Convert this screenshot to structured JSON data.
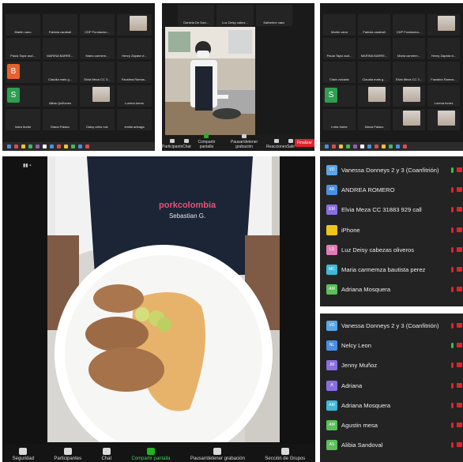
{
  "colors": {
    "panel_bg": "#1a1a1a",
    "tile_bg": "#242424",
    "mic_on": "#35c24a",
    "muted": "#e0232f",
    "share_green": "#1fb51f"
  },
  "panel_top_left": {
    "corner_label": "⊞ ⊟",
    "tiles": [
      {
        "name": "Martin vano"
      },
      {
        "name": "Fabiola carabali"
      },
      {
        "name": "CDP Fundacion..."
      },
      {
        "name": "",
        "thumb": true
      },
      {
        "name": "Paula Tapiz aud..."
      },
      {
        "name": "MARINA BARRE..."
      },
      {
        "name": "Maria carmem..."
      },
      {
        "name": "Henry Zapata vi..."
      },
      {
        "name": "",
        "avatar": "B",
        "avatar_color": "#e8612c"
      },
      {
        "name": "Claudia mats g..."
      },
      {
        "name": "Elvia Meza CC 3..."
      },
      {
        "name": "Faustina Ramos..."
      },
      {
        "name": "",
        "avatar": "S",
        "avatar_color": "#2e9e4f"
      },
      {
        "name": "Alibia Quiñones"
      },
      {
        "name": "",
        "thumb": true
      },
      {
        "name": "Lorena torres"
      },
      {
        "name": "Indra Iturbe"
      },
      {
        "name": "Diana Palaco"
      },
      {
        "name": "Daisy cetro ruiz"
      },
      {
        "name": "emilia arteaga"
      }
    ]
  },
  "panel_top_middle": {
    "tiles": [
      {
        "name": "Daniela De Gari..."
      },
      {
        "name": "Luz Deisy cabez..."
      },
      {
        "name": "Katherine vaez"
      }
    ],
    "controls": [
      {
        "label": "Participants"
      },
      {
        "label": "Chat"
      },
      {
        "label": "Compartir pantalla"
      },
      {
        "label": "Pausar/detener grabación"
      },
      {
        "label": "Reacciones"
      },
      {
        "label": "Salir"
      }
    ],
    "leave_label": "Finalizar"
  },
  "panel_top_right": {
    "tiles": [
      {
        "name": "Martin vano"
      },
      {
        "name": "Fabiola carabali"
      },
      {
        "name": "CDP Fundacion..."
      },
      {
        "name": "",
        "thumb": true
      },
      {
        "name": "Paula Tapiz aud..."
      },
      {
        "name": "MARINA BARRE..."
      },
      {
        "name": "Maria carmem..."
      },
      {
        "name": "Henry Zapata vi..."
      },
      {
        "name": "Clara volcanic"
      },
      {
        "name": "Claudia mats g..."
      },
      {
        "name": "Elvia Meza CC 3..."
      },
      {
        "name": "Faustina Ramos..."
      },
      {
        "name": "",
        "avatar": "S",
        "avatar_color": "#2e9e4f"
      },
      {
        "name": "",
        "thumb": true
      },
      {
        "name": "",
        "thumb": true
      },
      {
        "name": "Lorena torres"
      },
      {
        "name": "Indra Iturbe"
      },
      {
        "name": "Diana Palaco"
      },
      {
        "name": "",
        "thumb": true
      },
      {
        "name": "",
        "thumb": true
      }
    ]
  },
  "main_video": {
    "apron_brand": "porkcolombia",
    "apron_sub": "Sebastian G.",
    "view_label": "▮▮ ▪",
    "controls": [
      {
        "label": "Seguridad",
        "icon": "shield-icon"
      },
      {
        "label": "Participantes",
        "icon": "participants-icon",
        "count": "32"
      },
      {
        "label": "Chat",
        "icon": "chat-icon",
        "badge": "2"
      },
      {
        "label": "Compartir pantalla",
        "icon": "share-screen-icon"
      },
      {
        "label": "Pausar/detener grabación",
        "icon": "pause-icon"
      },
      {
        "label": "Sección de Grupos",
        "icon": "breakout-icon"
      }
    ]
  },
  "participants_list_1": [
    {
      "name": "Vanessa Donneys 2 y 3 (Coanfitrión)",
      "initials": "VD",
      "color": "#5aa6e6",
      "mic": "on"
    },
    {
      "name": "ANDREA ROMERO",
      "initials": "AR",
      "color": "#4b8fe0",
      "mic": "muted"
    },
    {
      "name": "Elvia Meza CC 31883 929 call",
      "initials": "EM",
      "color": "#8a6ee0",
      "mic": "muted"
    },
    {
      "name": "iPhone",
      "initials": "",
      "color": "#f0c419",
      "mic": "muted"
    },
    {
      "name": "Luz Deisy cabezas oliveros",
      "initials": "LD",
      "color": "#e07bb6",
      "mic": "muted"
    },
    {
      "name": "Maria carmemza bautista perez",
      "initials": "MC",
      "color": "#3fb8d6",
      "mic": "muted"
    },
    {
      "name": "Adriana Mosquera",
      "initials": "AM",
      "color": "#5bbf5a",
      "mic": "muted"
    }
  ],
  "participants_list_2": [
    {
      "name": "Vanessa Donneys 2 y 3 (Coanfitrión)",
      "initials": "VD",
      "color": "#5aa6e6",
      "mic": "muted"
    },
    {
      "name": "Nelcy Leon",
      "initials": "NL",
      "color": "#4b8fe0",
      "mic": "on"
    },
    {
      "name": "Jenny Muñoz",
      "initials": "JM",
      "color": "#8a6ee0",
      "mic": "muted"
    },
    {
      "name": "Adriana",
      "initials": "A",
      "color": "#8a6ee0",
      "mic": "muted"
    },
    {
      "name": "Adriana Mosquera",
      "initials": "AM",
      "color": "#3fb8d6",
      "mic": "muted"
    },
    {
      "name": "Agustin mesa",
      "initials": "AM",
      "color": "#5bbf5a",
      "mic": "muted"
    },
    {
      "name": "Alibia Sandoval",
      "initials": "AS",
      "color": "#5bbf5a",
      "mic": "muted"
    }
  ]
}
